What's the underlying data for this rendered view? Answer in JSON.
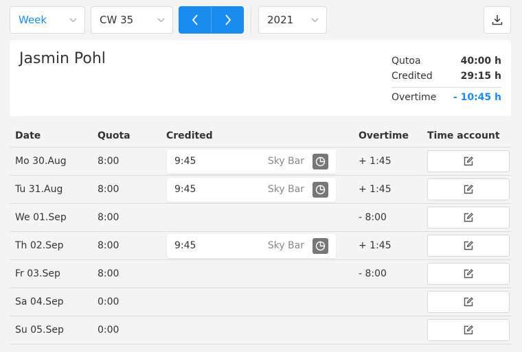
{
  "toolbar": {
    "period": "Week",
    "week": "CW 35",
    "year": "2021"
  },
  "summary": {
    "name": "Jasmin Pohl",
    "quota_label": "Qutoa",
    "quota_value": "40:00 h",
    "credited_label": "Credited",
    "credited_value": "29:15 h",
    "overtime_label": "Overtime",
    "overtime_value": "- 10:45 h"
  },
  "table": {
    "headers": {
      "date": "Date",
      "quota": "Quota",
      "credited": "Credited",
      "overtime": "Overtime",
      "account": "Time account"
    },
    "rows": [
      {
        "date": "Mo 30.Aug",
        "quota": "8:00",
        "credited_time": "9:45",
        "credited_place": "Sky Bar",
        "overtime": "+ 1:45"
      },
      {
        "date": "Tu 31.Aug",
        "quota": "8:00",
        "credited_time": "9:45",
        "credited_place": "Sky Bar",
        "overtime": "+ 1:45"
      },
      {
        "date": "We 01.Sep",
        "quota": "8:00",
        "credited_time": "",
        "credited_place": "",
        "overtime": "- 8:00"
      },
      {
        "date": "Th 02.Sep",
        "quota": "8:00",
        "credited_time": "9:45",
        "credited_place": "Sky Bar",
        "overtime": "+ 1:45"
      },
      {
        "date": "Fr 03.Sep",
        "quota": "8:00",
        "credited_time": "",
        "credited_place": "",
        "overtime": "- 8:00"
      },
      {
        "date": "Sa 04.Sep",
        "quota": "0:00",
        "credited_time": "",
        "credited_place": "",
        "overtime": ""
      },
      {
        "date": "Su 05.Sep",
        "quota": "0:00",
        "credited_time": "",
        "credited_place": "",
        "overtime": ""
      }
    ]
  },
  "icons": {
    "chevron": "chevron-down-icon",
    "prev": "chevron-left-icon",
    "next": "chevron-right-icon",
    "download": "download-icon",
    "pie": "pie-chart-icon",
    "edit": "edit-icon"
  },
  "colors": {
    "accent": "#1a8cf0",
    "pie_bg": "#777777"
  }
}
